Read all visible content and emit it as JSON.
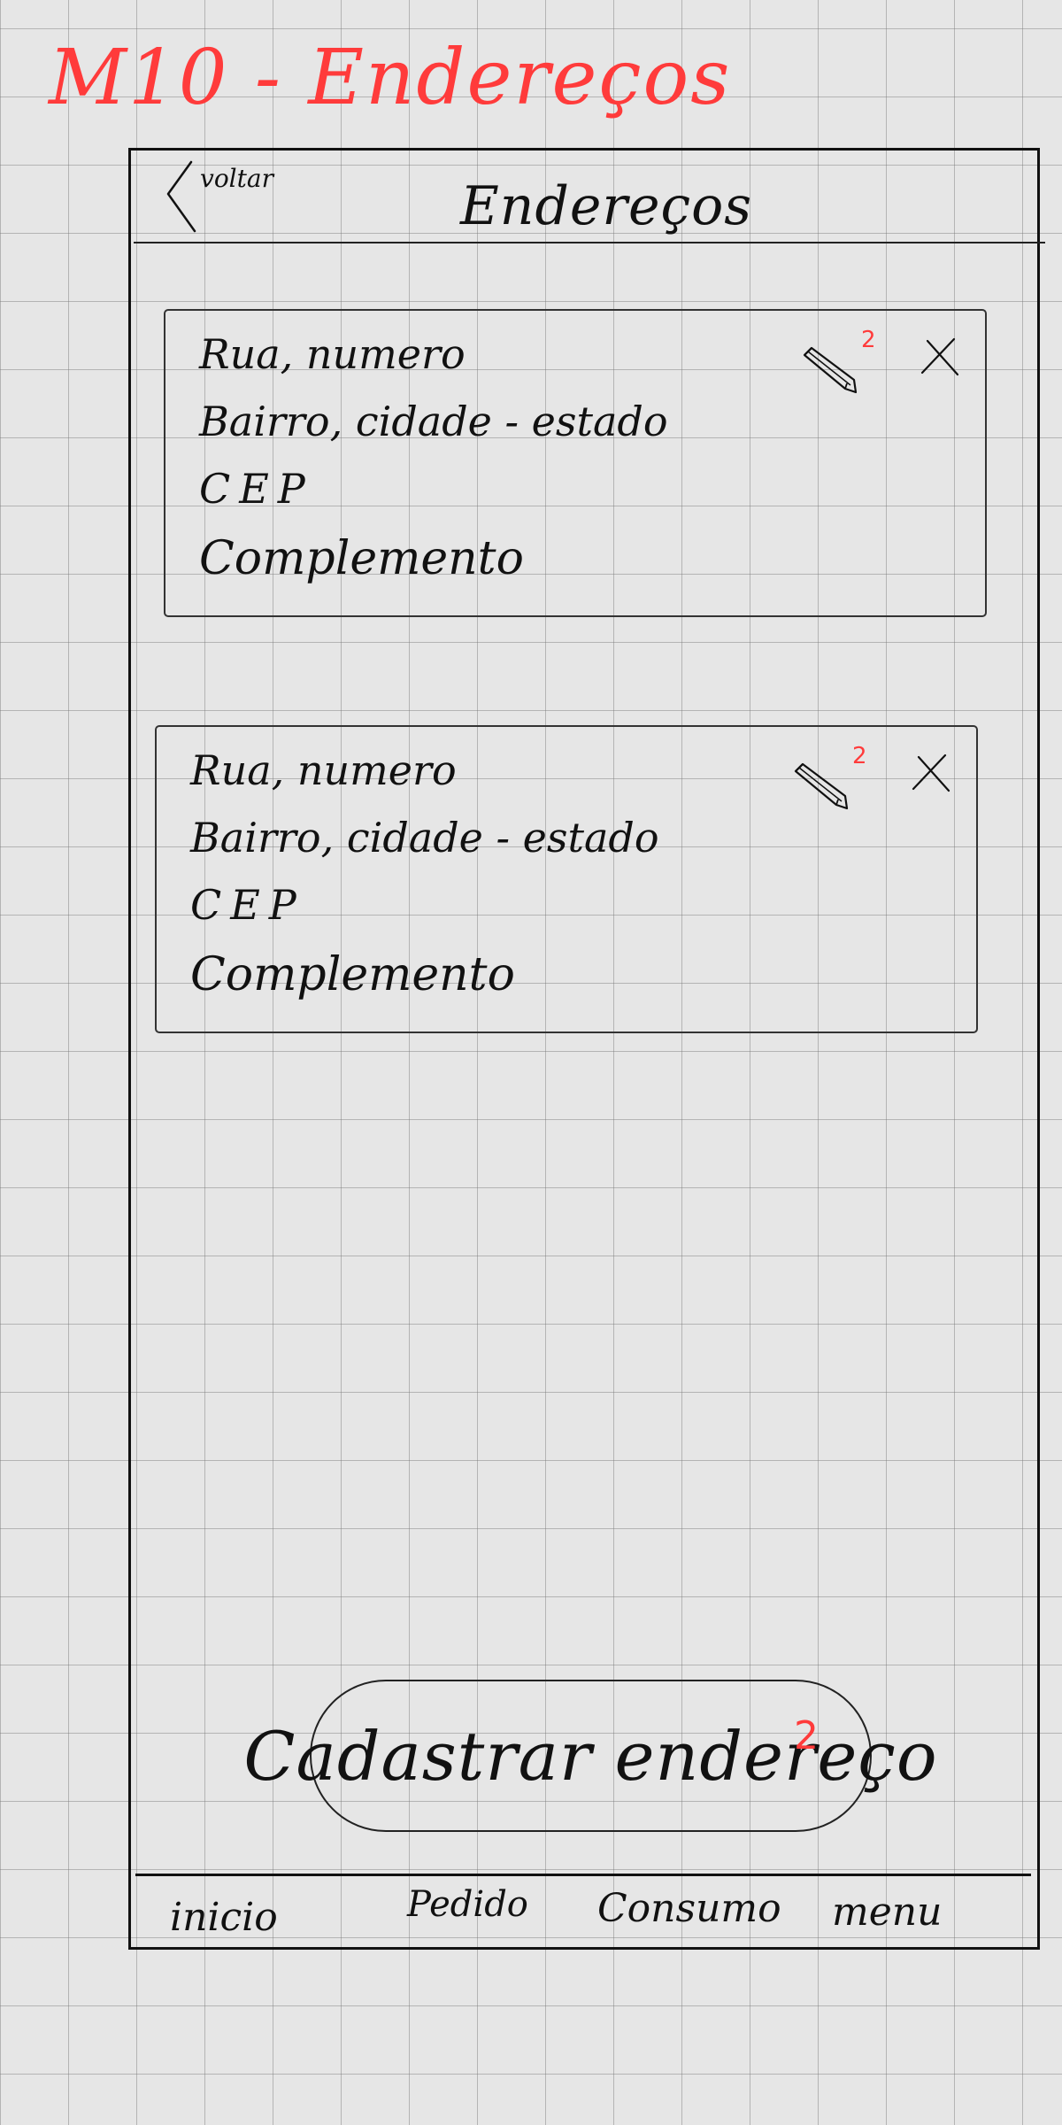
{
  "sheet": {
    "title": "M10 - Endereços"
  },
  "header": {
    "back_label": "voltar",
    "title": "Endereços"
  },
  "addresses": [
    {
      "street": "Rua, numero",
      "district": "Bairro, cidade - estado",
      "cep": "CEP",
      "complement": "Complemento",
      "edit_ref": "2"
    },
    {
      "street": "Rua, numero",
      "district": "Bairro, cidade - estado",
      "cep": "CEP",
      "complement": "Complemento",
      "edit_ref": "2"
    }
  ],
  "actions": {
    "register_label": "Cadastrar endereço",
    "register_ref": "2"
  },
  "bottom_nav": {
    "items": [
      "inicio",
      "Pedido",
      "Consumo",
      "menu"
    ]
  },
  "colors": {
    "annotation": "#ff3b3b",
    "ink": "#111111",
    "paper": "#e6e6e6"
  },
  "icons": {
    "back": "chevron-left-icon",
    "edit": "pencil-icon",
    "remove": "close-icon"
  }
}
